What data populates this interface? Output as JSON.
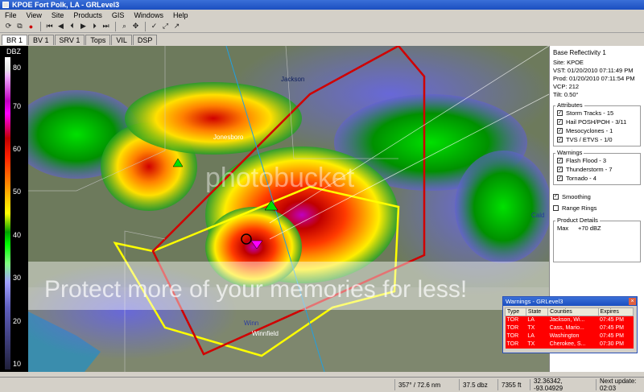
{
  "window": {
    "title": "KPOE Fort Polk, LA - GRLevel3"
  },
  "menu": [
    "File",
    "View",
    "Site",
    "Products",
    "GIS",
    "Windows",
    "Help"
  ],
  "tabs": [
    "BR 1",
    "BV 1",
    "SRV 1",
    "Tops",
    "VIL",
    "DSP"
  ],
  "scale": {
    "unit": "DBZ",
    "ticks": [
      "80",
      "70",
      "60",
      "50",
      "40",
      "30",
      "20",
      "10"
    ]
  },
  "map_labels": {
    "jackson": "Jackson",
    "jonesboro": "Jonesboro",
    "winnfield": "Winnfield",
    "winn": "Winn",
    "cald": "Cald"
  },
  "watermark": {
    "brand": "photobucket",
    "tagline": "Protect more of your memories for less!"
  },
  "panel": {
    "title": "Base Reflectivity 1",
    "info": [
      "Site: KPOE",
      "VST: 01/20/2010 07:11:49 PM",
      "Prod: 01/20/2010 07:11:54 PM",
      "VCP: 212",
      "Tilt: 0.50°"
    ],
    "attributes_title": "Attributes",
    "attributes": [
      "Storm Tracks - 15",
      "Hail POSH/POH - 3/11",
      "Mesocyclones - 1",
      "TVS / ETVS - 1/0"
    ],
    "warnings_title": "Warnings",
    "warnings": [
      "Flash Flood - 3",
      "Thunderstorm - 7",
      "Tornado - 4"
    ],
    "smoothing": "Smoothing",
    "range_rings": "Range Rings",
    "product_details_title": "Product Details",
    "max_label": "Max",
    "max_value": "+70 dBZ"
  },
  "warnings_window": {
    "title": "Warnings - GRLevel3",
    "columns": [
      "Type",
      "State",
      "Counties",
      "Expires"
    ],
    "rows": [
      [
        "TOR",
        "LA",
        "Jackson, Wi...",
        "07:45 PM"
      ],
      [
        "TOR",
        "TX",
        "Cass, Mario...",
        "07:45 PM"
      ],
      [
        "TOR",
        "LA",
        "Washington",
        "07:45 PM"
      ],
      [
        "TOR",
        "TX",
        "Cherokee, S...",
        "07:30 PM"
      ]
    ]
  },
  "status": {
    "azimuth": "357° / 72.6 nm",
    "dbz": "37.5 dbz",
    "height": "7355 ft",
    "coords": "32.36342, -93.04929",
    "next_update": "Next update: 02:03"
  },
  "colors": {
    "accent": "#1b4fc0",
    "warning_row": "#ff0000"
  }
}
